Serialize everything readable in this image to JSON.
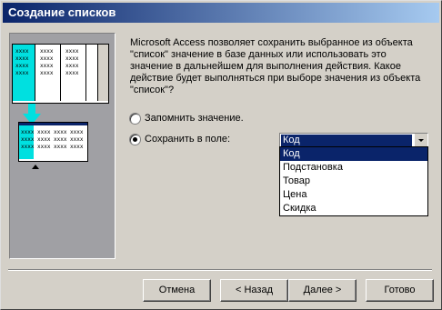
{
  "window": {
    "title": "Создание списков"
  },
  "illustration": {
    "cell_text": "xxxx"
  },
  "description": "Microsoft Access позволяет сохранить выбранное из объекта \"список\" значение в базе данных или использовать это значение в дальнейшем для выполнения действия.  Какое действие будет выполняться при выборе значения из объекта \"список\"?",
  "options": {
    "remember_label": "Запомнить значение.",
    "save_label": "Сохранить в поле:",
    "selected": "save"
  },
  "field_combo": {
    "value": "Код",
    "items": [
      "Код",
      "Подстановка",
      "Товар",
      "Цена",
      "Скидка"
    ],
    "selected_index": 0
  },
  "buttons": {
    "cancel": "Отмена",
    "back": "< Назад",
    "next": "Далее >",
    "finish": "Готово"
  },
  "colors": {
    "titlebar": "#0a246a",
    "highlight": "#0a246a",
    "illustration_bg": "#a0a0a4",
    "cyan": "#00e0e0"
  }
}
